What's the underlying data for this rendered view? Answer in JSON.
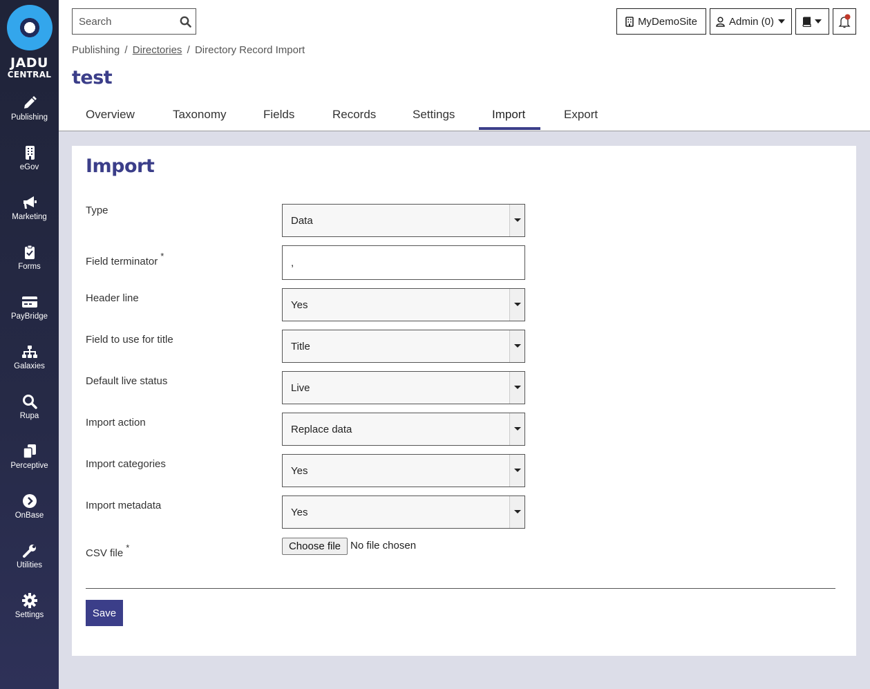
{
  "brand": {
    "line1": "JADU",
    "line2": "CENTRAL"
  },
  "sidebar": {
    "items": [
      {
        "label": "Publishing",
        "icon": "pencil-icon"
      },
      {
        "label": "eGov",
        "icon": "building-icon"
      },
      {
        "label": "Marketing",
        "icon": "megaphone-icon"
      },
      {
        "label": "Forms",
        "icon": "clipboard-check-icon"
      },
      {
        "label": "PayBridge",
        "icon": "credit-card-icon"
      },
      {
        "label": "Galaxies",
        "icon": "sitemap-icon"
      },
      {
        "label": "Rupa",
        "icon": "search-icon"
      },
      {
        "label": "Perceptive",
        "icon": "copy-icon"
      },
      {
        "label": "OnBase",
        "icon": "chevron-circle-icon"
      },
      {
        "label": "Utilities",
        "icon": "wrench-icon"
      },
      {
        "label": "Settings",
        "icon": "gear-icon"
      }
    ]
  },
  "topbar": {
    "search_placeholder": "Search",
    "site_label": "MyDemoSite",
    "user_label": "Admin (0)"
  },
  "breadcrumb": {
    "root": "Publishing",
    "sep": "/",
    "link": "Directories",
    "current": "Directory Record Import"
  },
  "page": {
    "title": "test"
  },
  "tabs": [
    {
      "label": "Overview"
    },
    {
      "label": "Taxonomy"
    },
    {
      "label": "Fields"
    },
    {
      "label": "Records"
    },
    {
      "label": "Settings"
    },
    {
      "label": "Import"
    },
    {
      "label": "Export"
    }
  ],
  "active_tab": "Import",
  "form": {
    "heading": "Import",
    "type": {
      "label": "Type",
      "value": "Data"
    },
    "field_terminator": {
      "label": "Field terminator",
      "required": "*",
      "value": ","
    },
    "header_line": {
      "label": "Header line",
      "value": "Yes"
    },
    "title_field": {
      "label": "Field to use for title",
      "value": "Title"
    },
    "live_status": {
      "label": "Default live status",
      "value": "Live"
    },
    "import_action": {
      "label": "Import action",
      "value": "Replace data"
    },
    "import_categories": {
      "label": "Import categories",
      "value": "Yes"
    },
    "import_metadata": {
      "label": "Import metadata",
      "value": "Yes"
    },
    "csv_file": {
      "label": "CSV file",
      "required": "*",
      "button": "Choose file",
      "status": "No file chosen"
    },
    "save_label": "Save"
  },
  "colors": {
    "accent": "#3b3e89",
    "sidebar": "#262a47",
    "logo": "#33a6ec",
    "notification": "#c0392b"
  }
}
